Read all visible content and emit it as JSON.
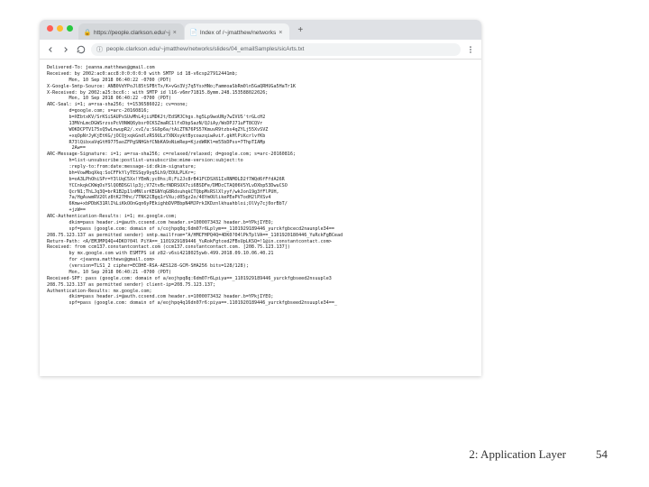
{
  "tabs": [
    {
      "label": "https://people.clarkson.edu/~j",
      "active": false
    },
    {
      "label": "Index of /~jmatthew/networks",
      "active": true
    }
  ],
  "address": "people.clarkson.edu/~jmatthew/networks/slides/04_emailSamples/sicArts.txt",
  "email_lines": [
    "Delivered-To: jeanna.matthews@gmail.com",
    "Received: by 2002:ac0:acc8:0:0:0:0:0 with SMTP id 18-v6csp27912441mb;",
    "        Mon, 10 Sep 2018 06:40:22 -0700 (PDT)",
    "X-Google-Smtp-Source: ANB0VdYPoJl85tSPBtTx/K+vGo3Vj7q5YsxHNo;FammoaSbRm0ln5GaQRHUGa5HaTr1K",
    "X-Received: by 2002:a25:bcc6:: with SMTP id l16-v6mr71815.8ymm.248.153588022026;",
    "        Mon, 10 Sep 2018 06:40:22 -0700 (PDT)",
    "ARC-Seal: i=1; a=rsa-sha256; t=1536586022; cv=none;",
    "        d=google.com; s=arc-20160816;",
    "        b=XEbtxKV/SrKSiSAUPsSUvMhL4jiiMDKJt/EdSMJChgs.hg5Lp9woUNy7wIVUS'trGLcH2",
    "        13MVnLmcDGWSrzssPcV0NWQ6ybsr0CKSZmaRC1lfxDbpSazN/QJiAy/WoDPJ71uFT8CQVr",
    "        WOKDCPTV175sQ5wLnwupR2/.xvI/u:SG9p6a/tAiZTN76PS57KmuvR9tzbs4qZYLj55XvSVZ",
    "        +xqOpNrJyKjEtKG/jOCQjxqkGndlzRS9ULz7XNXsyktBycoazqiwAvif.gkHlPiKcrlvfKb",
    "        R73lQibxaVqGtH9775aoZFPgSNHGhfCNbKA9oNimRep=KjzdWRKl=m55bDPss=7ThpTIAMp",
    "         2Aw==",
    "ARC-Message-Signature: i=1; a=rsa-sha256; c=relaxed/relaxed; d=google.com; s=arc-20160816;",
    "        h=list-unsubscribe:postlist-unsubscribe:mime-version:subject:to",
    "        :reply-to:from:date:message-id:dkim-signature;",
    "        bh=VowMbqXkq:SoCFFkYlyTESSqy9yq5Lh9/EOULPLKr=;",
    "        b=oA3LPhOhiSPr=Y3lUqC5Xx!YEmN;yc0hs;R;Fi2Jc8rB41FCDSX61IsRNMOLD2f7WQd6fFfdA26R",
    "        YCCnkqkCKWqOsYSlQOBDSGllp3j;V7ZtvBcfNDRSOX7ci6BSDFe/DMDcCTAQ06VSYLvDXbp53DwuCSO",
    "        QcrN1;ThLJq3Q=brR1B2p1lnMNlsrKEGNYqG8RdsuhqkCTQbpMsRSlXlyyf/wkJon19g3fFlPUH,",
    "        7a/HgAvwmRV2Olz8tK27Hhc/7TNK2CBgq1rVXu;d05gz2o/48YmOUlikePEePV7odH2lPXSv4",
    "        6Kmw+xbPDbK31RlI%LiKkOOnGqn6yPEkighbDVPBbpN4MJPrkIKDznlkhuahbloi;OlVy7cj0orBbT/",
    "        +jzW==",
    "ARC-Authentication-Results: i=1; mx.google.com;",
    "        dkim=pass header.i=@auth.ccsend.com header.s=1000073432 header.b=YPkjIYEO;",
    "        spf=pass (google.com: domain of s/cojhpq8q;6dm07r6Lplym==_1101929189446_yurckfgbcecd2naunple34==",
    "208.75.123.137 as permitted sender) smtp.mailfrom=\"A/HMCFHPQ4Q=4DK0?04lPkTplVA==_1101920180446_YuRckFgBCead",
    "Return-Path: <A/EMJMPQ4Q+4DKO?04l PiYA==_1101929189446_YuRokFgtced2FBsUpLKSQ=!1@in.constantcontact.com>",
    "Received: from ccm137.constantcontact.com (ccm137.constantcontact.com. [208.75.123.137])",
    "        by mx.google.com with ESMTPS id z82-v6si4218025ywb.499.2018.09.10.06.40.21",
    "        for <jeanna.matthews@gmail.com>",
    "        (version=TLS1_2 cipher=ECDHE-RSA-AES128-GCM-SHA256 bits=128/128);",
    "        Mon, 10 Sep 2018 06:40:21 -0700 (PDT)",
    "Received-SPF: pass (google.com: domain of a/eojhpq8q:6dm07r6Lpiya==_1101929189446_yurckfgbseed2nsuuple3",
    "208.75.123.137 as permitted sender) client-ip=208.75.123.137;",
    "Authentication-Results: mx.google.com;",
    "        dkim=pass header.i=@auth.ccsend.com header.s=1000073432 header.b=YPkjIYEO;",
    "        spf=pass (google.com: domain of a/eojhpq4q16dn07r6:piya==.1101920189446_yurckfgbseed2nsuuple34==_"
  ],
  "footer": {
    "label": "2: Application Layer",
    "page": "54"
  }
}
